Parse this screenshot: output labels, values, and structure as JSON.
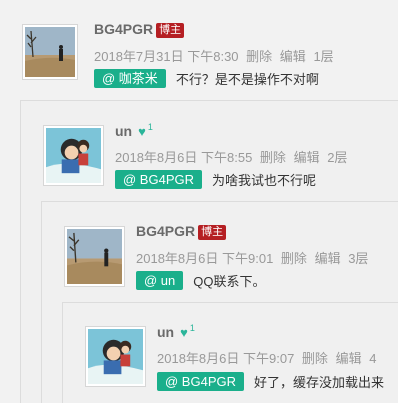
{
  "colors": {
    "mention_bg": "#1aaf8b",
    "badge_bg": "#b51f23",
    "heart": "#2bb59a"
  },
  "comments": [
    {
      "author": "BG4PGR",
      "badge": "博主",
      "date": "2018年7月31日 下午8:30",
      "delete": "删除",
      "edit": "编辑",
      "floor": "1层",
      "mention": "@ 咖茶米",
      "text": "不行？是不是操作不对啊"
    },
    {
      "author": "un",
      "likes": "1",
      "date": "2018年8月6日 下午8:55",
      "delete": "删除",
      "edit": "编辑",
      "floor": "2层",
      "mention": "@ BG4PGR",
      "text": "为啥我试也不行呢"
    },
    {
      "author": "BG4PGR",
      "badge": "博主",
      "date": "2018年8月6日 下午9:01",
      "delete": "删除",
      "edit": "编辑",
      "floor": "3层",
      "mention": "@ un",
      "text": "QQ联系下。"
    },
    {
      "author": "un",
      "likes": "1",
      "date": "2018年8月6日 下午9:07",
      "delete": "删除",
      "edit": "编辑",
      "floor": "4",
      "mention": "@ BG4PGR",
      "text": "好了，缓存没加载出来"
    }
  ]
}
